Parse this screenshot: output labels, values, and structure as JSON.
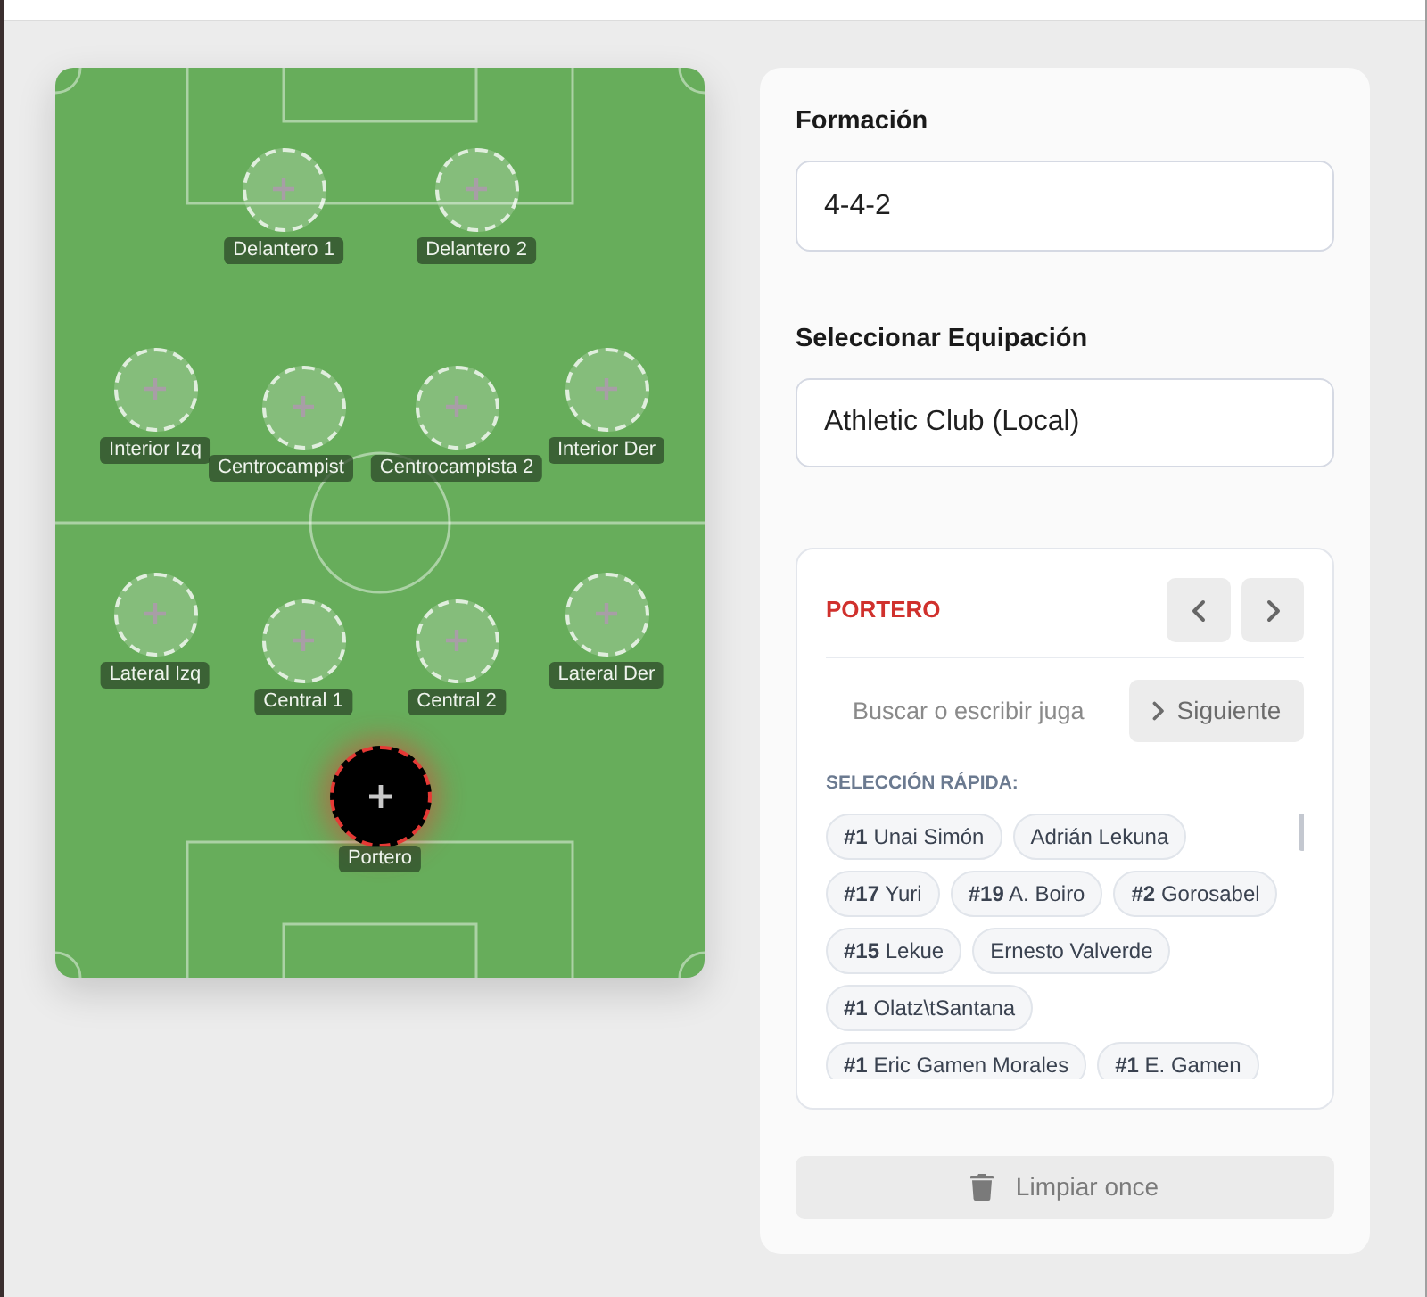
{
  "pitch": {
    "players": [
      {
        "position": "Delantero 1",
        "selected": false
      },
      {
        "position": "Delantero 2",
        "selected": false
      },
      {
        "position": "Interior Izq",
        "selected": false
      },
      {
        "position": "Centrocampist",
        "selected": false
      },
      {
        "position": "Centrocampista 2",
        "selected": false
      },
      {
        "position": "Interior Der",
        "selected": false
      },
      {
        "position": "Lateral Izq",
        "selected": false
      },
      {
        "position": "Central 1",
        "selected": false
      },
      {
        "position": "Central 2",
        "selected": false
      },
      {
        "position": "Lateral Der",
        "selected": false
      },
      {
        "position": "Portero",
        "selected": true
      }
    ]
  },
  "formation": {
    "label": "Formación",
    "value": "4-4-2"
  },
  "kit": {
    "label": "Seleccionar Equipación",
    "value": "Athletic Club (Local)"
  },
  "slot_panel": {
    "position": "PORTERO",
    "search": {
      "placeholder": "Buscar o escribir juga"
    },
    "next_button": "Siguiente",
    "quick_pick": {
      "label": "SELECCIÓN RÁPIDA:",
      "players": [
        {
          "number": "#1",
          "name": "Unai Simón"
        },
        {
          "name": "Adrián Lekuna"
        },
        {
          "number": "#17",
          "name": "Yuri"
        },
        {
          "number": "#19",
          "name": "A. Boiro"
        },
        {
          "number": "#2",
          "name": "Gorosabel"
        },
        {
          "number": "#15",
          "name": "Lekue"
        },
        {
          "name": "Ernesto Valverde"
        },
        {
          "number": "#1",
          "name": "Olatz\\tSantana"
        },
        {
          "number": "#1",
          "name": "Eric Gamen Morales"
        },
        {
          "number": "#1",
          "name": "E. Gamen"
        }
      ]
    }
  },
  "clear_button": {
    "label": "Limpiar once"
  }
}
